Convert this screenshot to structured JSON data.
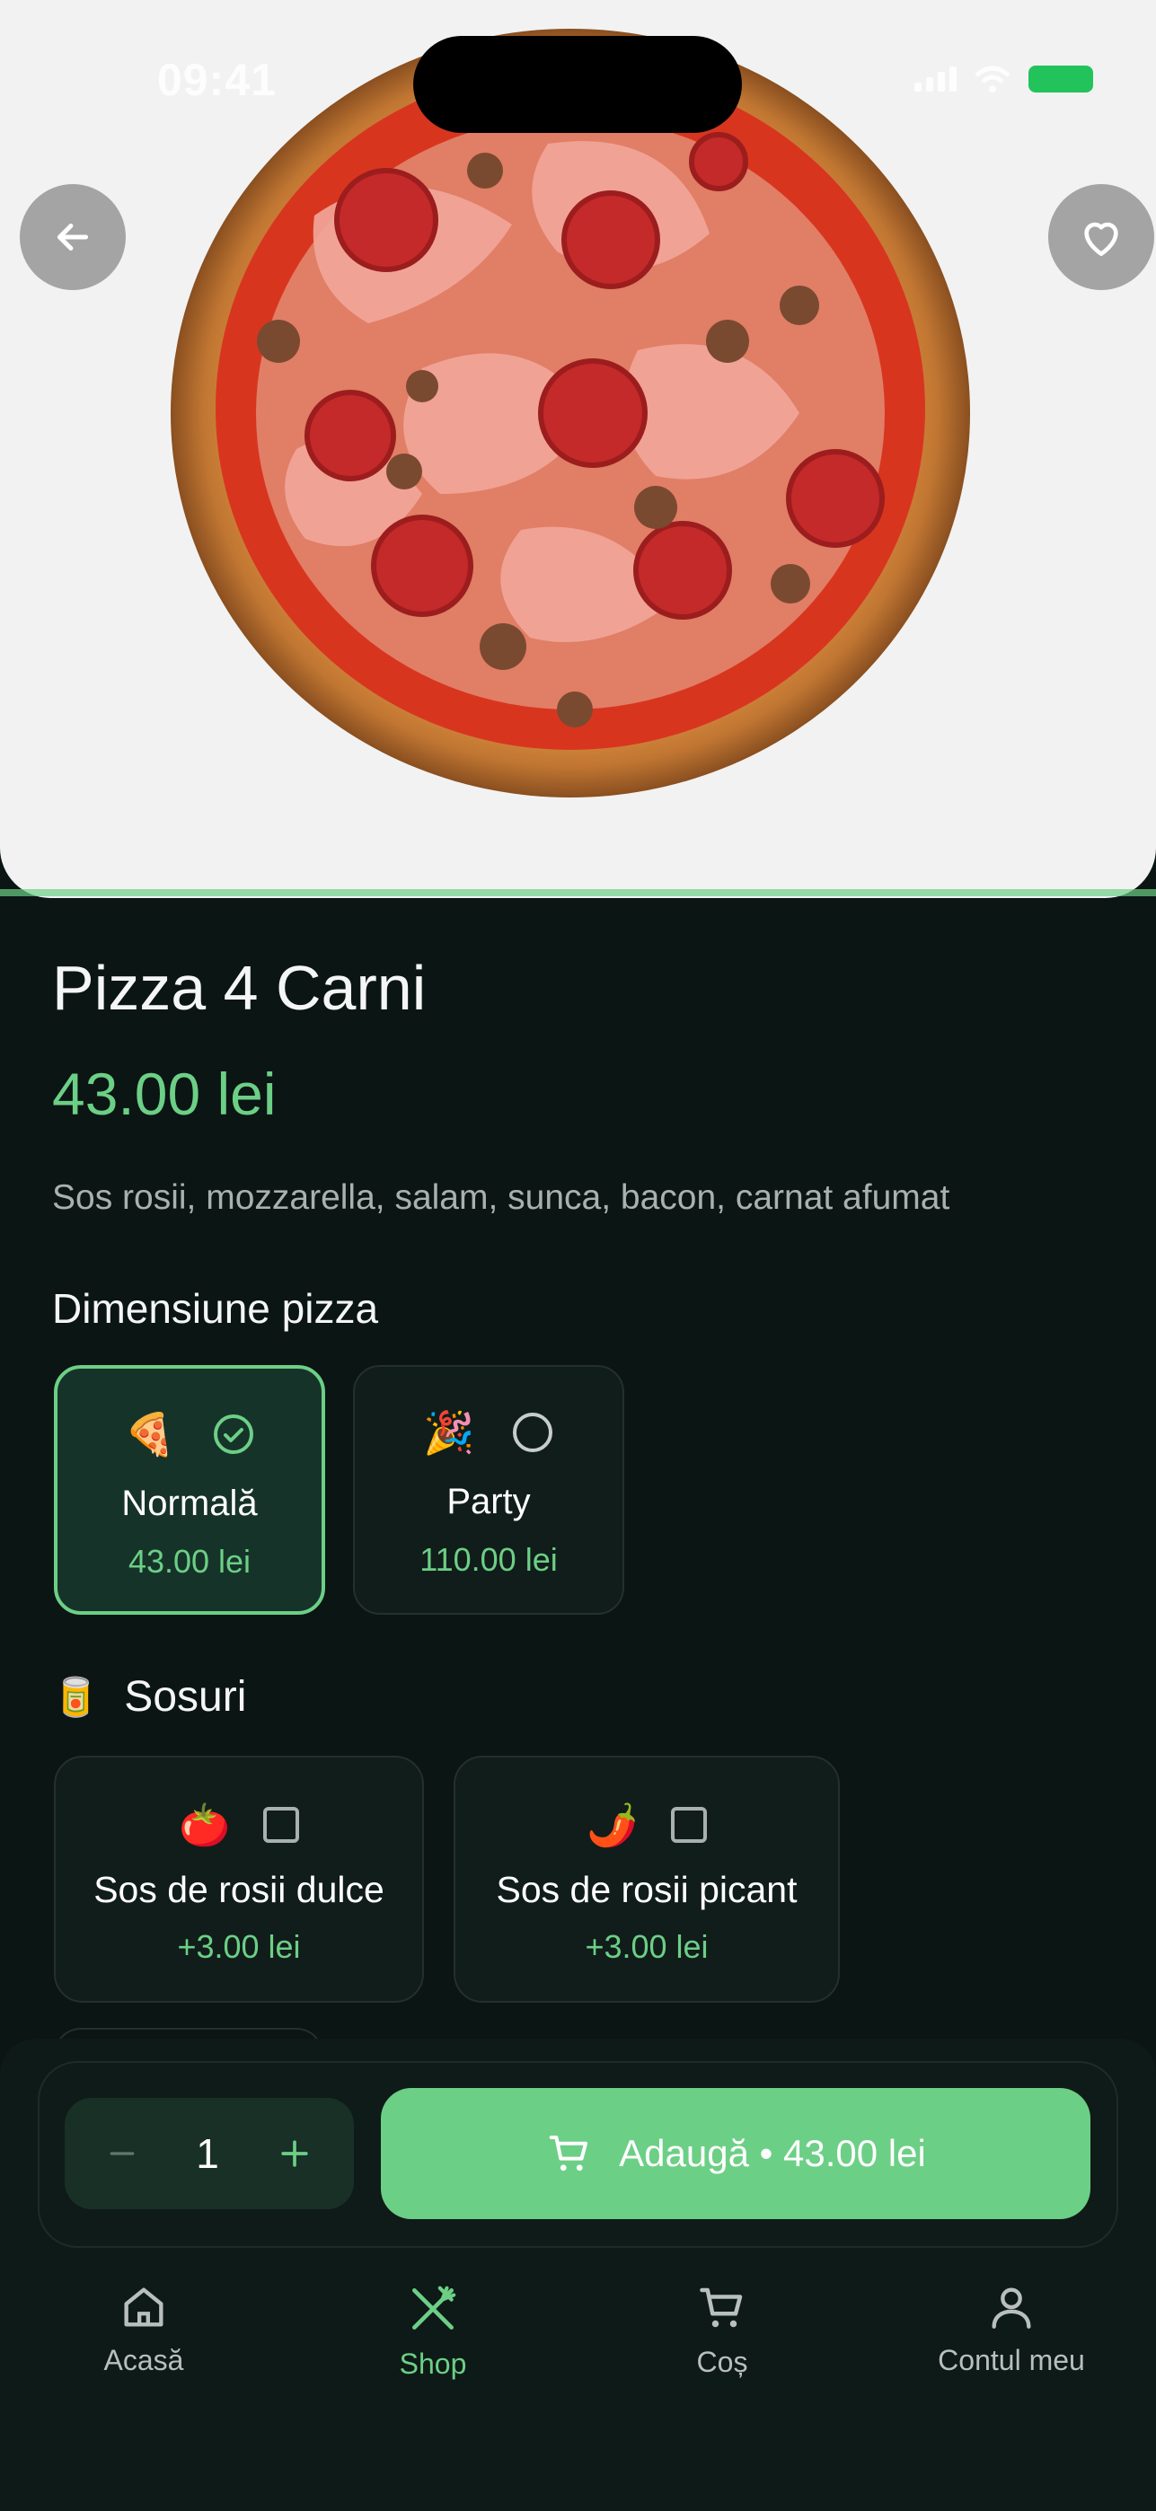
{
  "status_bar": {
    "time": "09:41"
  },
  "product": {
    "name": "Pizza 4 Carni",
    "price": "43.00 lei",
    "description": "Sos rosii, mozzarella, salam, sunca, bacon, carnat afumat"
  },
  "size_section": {
    "label": "Dimensiune pizza",
    "options": [
      {
        "emoji": "🍕",
        "name": "Normală",
        "price": "43.00 lei",
        "selected": true
      },
      {
        "emoji": "🎉",
        "name": "Party",
        "price": "110.00 lei",
        "selected": false
      }
    ]
  },
  "sauce_section": {
    "emoji": "🥫",
    "label": "Sosuri",
    "options": [
      {
        "emoji": "🍅",
        "name": "Sos de rosii dulce",
        "price": "+3.00 lei",
        "checked": false
      },
      {
        "emoji": "🌶️",
        "name": "Sos de rosii picant",
        "price": "+3.00 lei",
        "checked": false
      }
    ]
  },
  "cart_bar": {
    "quantity": "1",
    "add_label": "Adaugă • 43.00 lei"
  },
  "tabs": [
    {
      "label": "Acasă",
      "icon": "home-icon",
      "active": false
    },
    {
      "label": "Shop",
      "icon": "utensils-icon",
      "active": true
    },
    {
      "label": "Coș",
      "icon": "cart-icon",
      "active": false
    },
    {
      "label": "Contul meu",
      "icon": "user-icon",
      "active": false
    }
  ],
  "colors": {
    "accent": "#6ccf86",
    "background": "#0b1513",
    "card": "#111d1a"
  }
}
